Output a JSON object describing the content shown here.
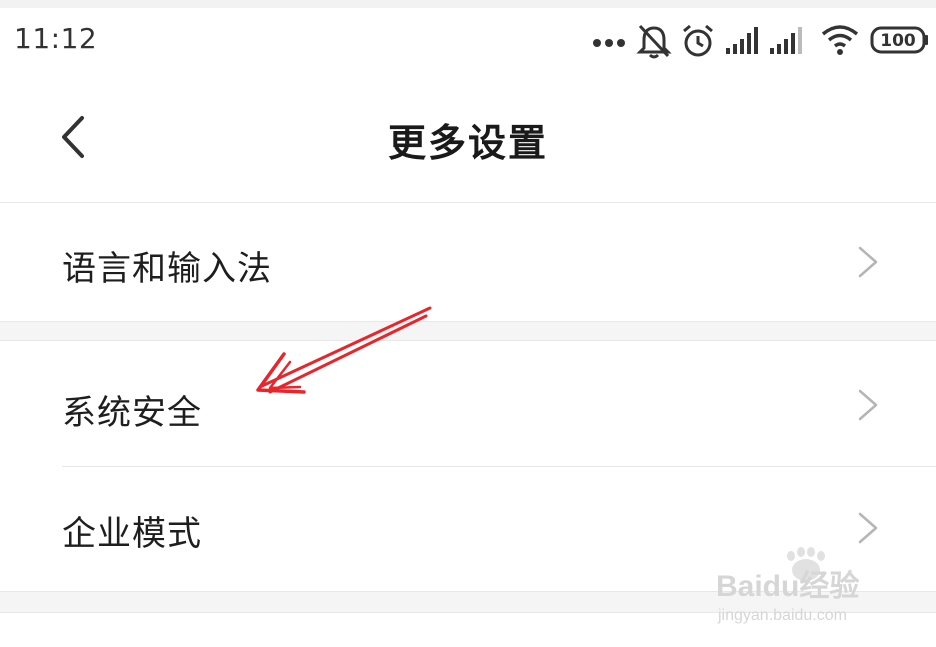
{
  "status_bar": {
    "time": "11:12",
    "icons": [
      "more-dots-icon",
      "mute-icon",
      "alarm-icon",
      "signal-icon",
      "signal-icon",
      "wifi-icon",
      "battery-icon"
    ],
    "battery": "100"
  },
  "header": {
    "title": "更多设置",
    "back_icon": "chevron-left-icon"
  },
  "settings": [
    {
      "label": "语言和输入法",
      "icon": "chevron-right-icon"
    },
    {
      "label": "系统安全",
      "icon": "chevron-right-icon"
    },
    {
      "label": "企业模式",
      "icon": "chevron-right-icon"
    }
  ],
  "annotation": {
    "arrow_color": "#e8252b"
  },
  "watermark": {
    "brand": "Baidu经验",
    "url": "jingyan.baidu.com"
  },
  "colors": {
    "background": "#f5f5f5",
    "panel": "#ffffff",
    "chevron": "#b5b5b5"
  }
}
